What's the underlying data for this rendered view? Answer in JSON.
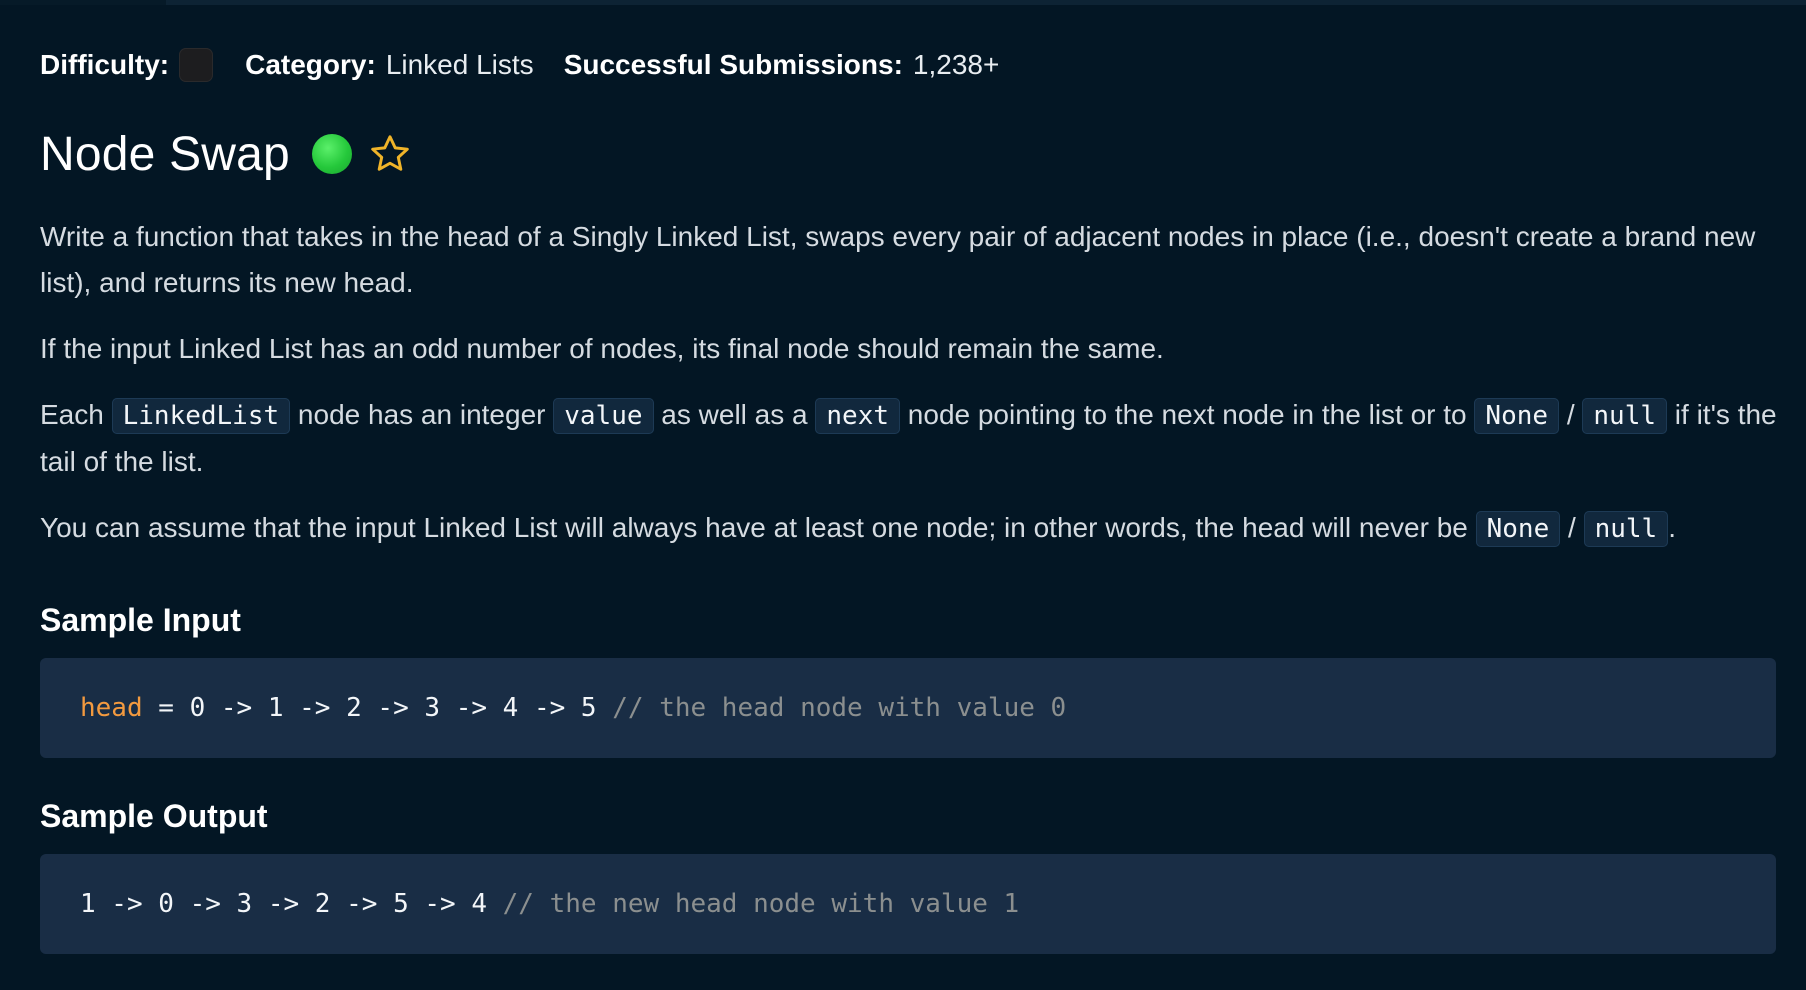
{
  "header": {
    "difficulty_label": "Difficulty:",
    "category_label": "Category:",
    "category_value": "Linked Lists",
    "submissions_label": "Successful Submissions:",
    "submissions_value": "1,238+"
  },
  "problem": {
    "title": "Node Swap",
    "status_color": "#25c83b",
    "favorite_icon": "star-outline-icon"
  },
  "description": {
    "p1": "Write a function that takes in the head of a Singly Linked List, swaps every pair of adjacent nodes in place (i.e., doesn't create a brand new list), and returns its new head.",
    "p2": "If the input Linked List has an odd number of nodes, its final node should remain the same.",
    "p3": {
      "t1": "Each ",
      "c1": "LinkedList",
      "t2": " node has an integer ",
      "c2": "value",
      "t3": " as well as a ",
      "c3": "next",
      "t4": " node pointing to the next node in the list or to ",
      "c4": "None",
      "t5": " / ",
      "c5": "null",
      "t6": " if it's the tail of the list."
    },
    "p4": {
      "t1": "You can assume that the input Linked List will always have at least one node; in other words, the head will never be ",
      "c1": "None",
      "t2": " / ",
      "c2": "null",
      "t3": "."
    }
  },
  "sample_input": {
    "heading": "Sample Input",
    "var": "head",
    "code": " = 0 -> 1 -> 2 -> 3 -> 4 -> 5 ",
    "comment": "// the head node with value 0"
  },
  "sample_output": {
    "heading": "Sample Output",
    "code": "1 -> 0 -> 3 -> 2 -> 5 -> 4 ",
    "comment": "// the new head node with value 1"
  },
  "colors": {
    "background": "#031624",
    "code_block": "#192d45",
    "keyword": "#f39a3f",
    "comment": "#8b8f8f",
    "star": "#f0b429"
  }
}
